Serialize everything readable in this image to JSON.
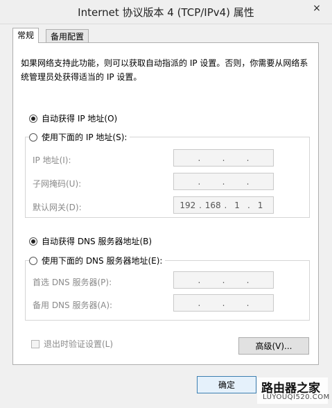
{
  "window": {
    "title": "Internet 协议版本 4 (TCP/IPv4) 属性",
    "close_icon": "×"
  },
  "tabs": [
    {
      "label": "常规",
      "active": true
    },
    {
      "label": "备用配置",
      "active": false
    }
  ],
  "description": "如果网络支持此功能，则可以获取自动指派的 IP 设置。否则，你需要从网络系统管理员处获得适当的 IP 设置。",
  "ip_section": {
    "auto_label": "自动获得 IP 地址(O)",
    "manual_label": "使用下面的 IP 地址(S):",
    "selected": "auto",
    "fields": [
      {
        "label": "IP 地址(I):",
        "octets": [
          "",
          "",
          "",
          ""
        ]
      },
      {
        "label": "子网掩码(U):",
        "octets": [
          "",
          "",
          "",
          ""
        ]
      },
      {
        "label": "默认网关(D):",
        "octets": [
          "192",
          "168",
          "1",
          "1"
        ]
      }
    ]
  },
  "dns_section": {
    "auto_label": "自动获得 DNS 服务器地址(B)",
    "manual_label": "使用下面的 DNS 服务器地址(E):",
    "selected": "auto",
    "fields": [
      {
        "label": "首选 DNS 服务器(P):",
        "octets": [
          "",
          "",
          "",
          ""
        ]
      },
      {
        "label": "备用 DNS 服务器(A):",
        "octets": [
          "",
          "",
          "",
          ""
        ]
      }
    ]
  },
  "validate_checkbox": {
    "label": "退出时验证设置(L)",
    "checked": false
  },
  "buttons": {
    "advanced": "高级(V)...",
    "ok": "确定"
  },
  "watermark": {
    "main": "路由器之家",
    "sub": "LUYOUQI520.COM"
  }
}
